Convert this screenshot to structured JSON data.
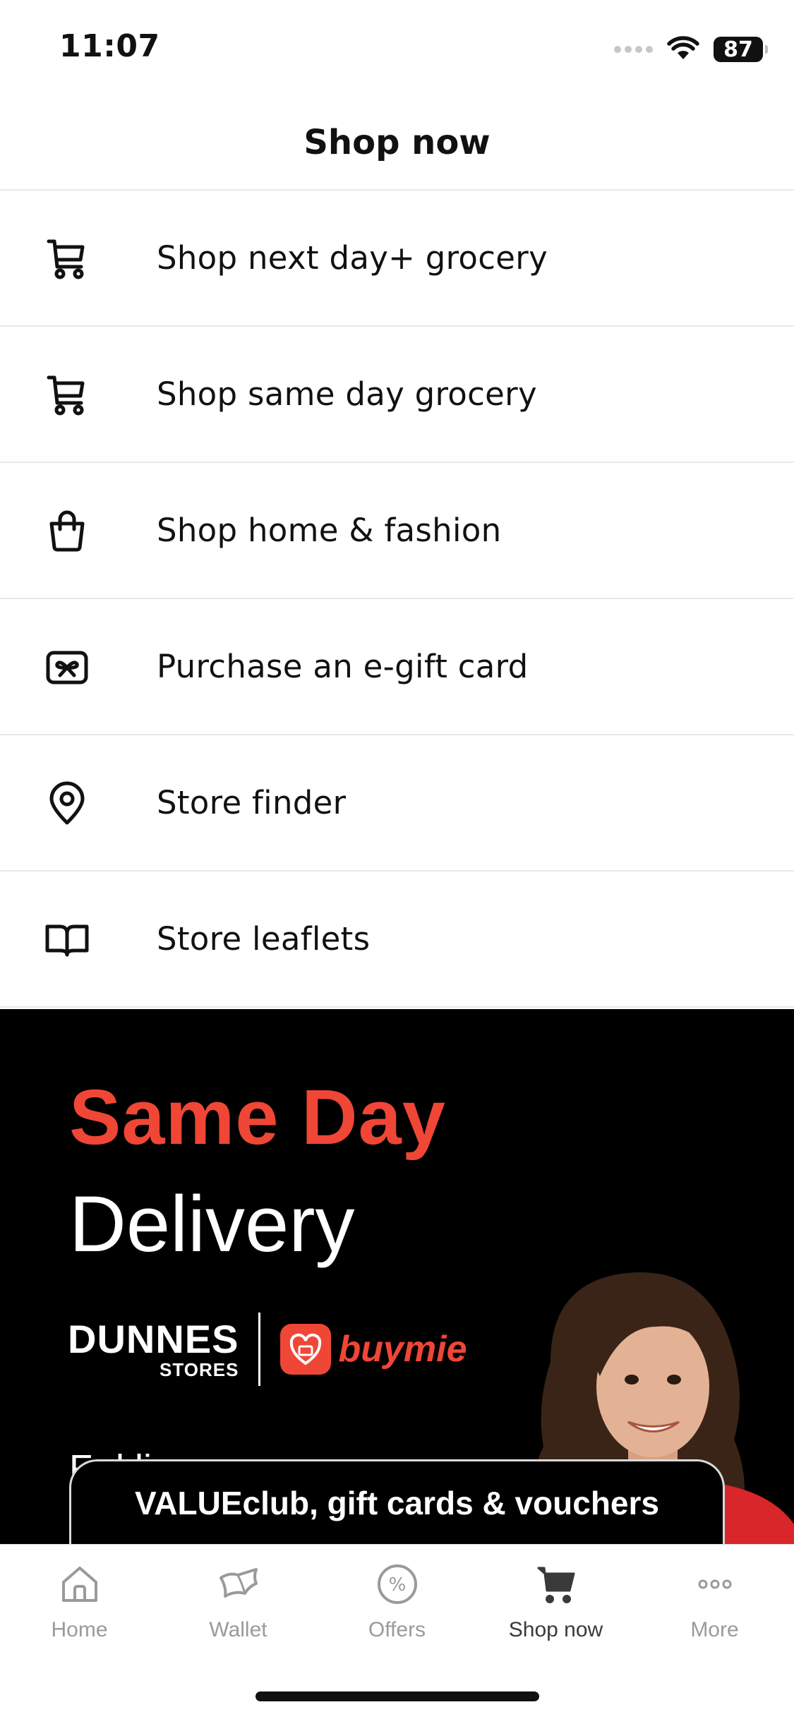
{
  "status_bar": {
    "time": "11:07",
    "battery": "87"
  },
  "header": {
    "title": "Shop now"
  },
  "menu": {
    "items": [
      {
        "label": "Shop next day+ grocery",
        "icon": "cart-icon"
      },
      {
        "label": "Shop same day grocery",
        "icon": "cart-icon"
      },
      {
        "label": "Shop home & fashion",
        "icon": "shopping-bag-icon"
      },
      {
        "label": "Purchase an e-gift card",
        "icon": "gift-card-icon"
      },
      {
        "label": "Store finder",
        "icon": "location-pin-icon"
      },
      {
        "label": "Store leaflets",
        "icon": "book-icon"
      }
    ]
  },
  "banner": {
    "headline": "Same Day",
    "subheadline": "Delivery",
    "brand_main": "DUNNES",
    "brand_sub": "STORES",
    "partner": "buymie",
    "partial_text": "F     d li",
    "headline_color": "#f04636"
  },
  "floating_button": {
    "label": "VALUEclub, gift cards & vouchers"
  },
  "tab_bar": {
    "tabs": [
      {
        "label": "Home",
        "icon": "home-icon"
      },
      {
        "label": "Wallet",
        "icon": "wallet-icon"
      },
      {
        "label": "Offers",
        "icon": "offers-icon"
      },
      {
        "label": "Shop now",
        "icon": "cart-icon",
        "active": true
      },
      {
        "label": "More",
        "icon": "more-icon"
      }
    ]
  }
}
